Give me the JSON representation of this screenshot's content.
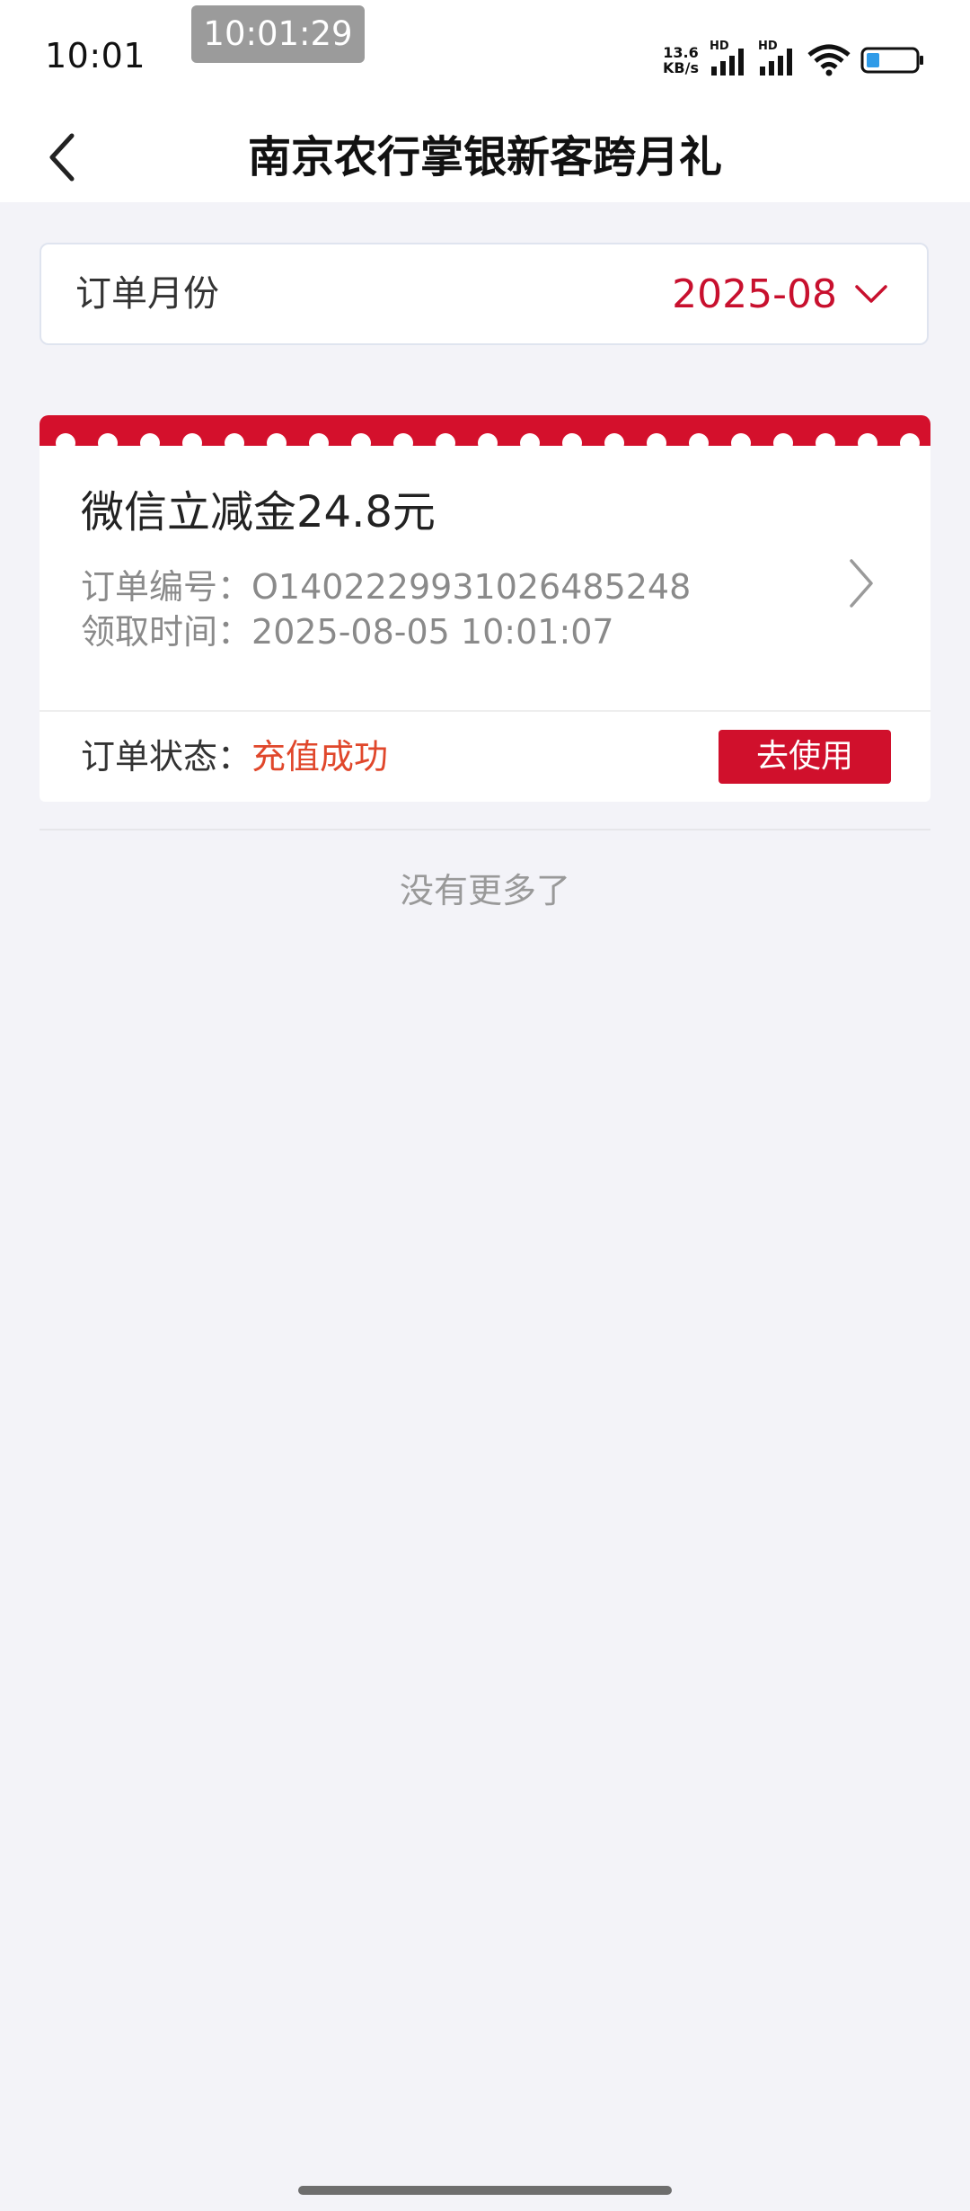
{
  "status_bar": {
    "time": "10:01",
    "overlay_time": "10:01:29",
    "net_speed_value": "13.6",
    "net_speed_unit": "KB/s",
    "hd_label": "HD",
    "icons": [
      "signal-icon",
      "signal-icon",
      "wifi-icon",
      "battery-icon"
    ]
  },
  "header": {
    "title": "南京农行掌银新客跨月礼",
    "back_icon": "chevron-left-icon"
  },
  "month_filter": {
    "label": "订单月份",
    "value": "2025-08",
    "dropdown_icon": "chevron-down-icon",
    "accent_color": "#c8102e"
  },
  "orders": [
    {
      "title": "微信立减金24.8元",
      "order_no_label": "订单编号：",
      "order_no": "O1402229931026485248",
      "receive_time_label": "领取时间：",
      "receive_time": "2025-08-05 10:01:07",
      "status_label": "订单状态：",
      "status_value": "充值成功",
      "action_label": "去使用"
    }
  ],
  "list_footer": "没有更多了"
}
